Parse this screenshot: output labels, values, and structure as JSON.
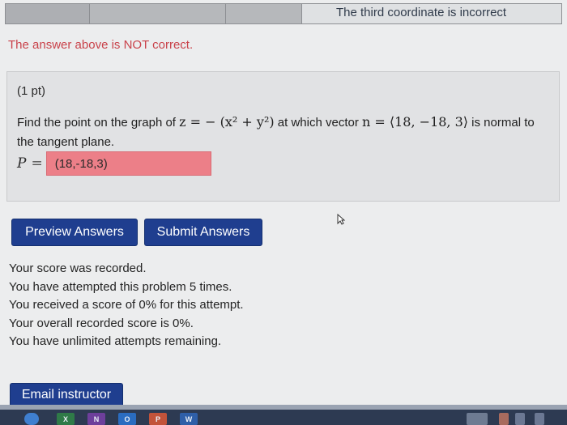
{
  "results_bar": {
    "message": "The third coordinate is incorrect"
  },
  "feedback": {
    "error_message": "The answer above is NOT correct."
  },
  "problem": {
    "points": "(1 pt)",
    "text_before": "Find the point on the graph of ",
    "math_surface": "z = − (x² + y²)",
    "text_middle": " at which vector ",
    "math_vector": "n = ⟨18, −18, 3⟩",
    "text_after": " is normal to the tangent plane.",
    "answer_label": "P",
    "answer_equals": "=",
    "answer_value": "(18,-18,3)"
  },
  "buttons": {
    "preview": "Preview Answers",
    "submit": "Submit Answers",
    "email": "Email instructor"
  },
  "score_messages": [
    "Your score was recorded.",
    "You have attempted this problem 5 times.",
    "You received a score of 0% for this attempt.",
    "Your overall recorded score is 0%.",
    "You have unlimited attempts remaining."
  ],
  "taskbar": {
    "icons": {
      "start": "windows-start-icon",
      "excel": "excel-icon",
      "onenote": "onenote-icon",
      "outlook": "outlook-icon",
      "powerpoint": "powerpoint-icon",
      "word": "word-icon"
    },
    "labels": {
      "excel": "X",
      "onenote": "N",
      "outlook": "O",
      "powerpoint": "P",
      "word": "W"
    }
  },
  "colors": {
    "error_text": "#c9424a",
    "incorrect_answer_fill": "#ec7f88",
    "button_blue": "#1f3e8f"
  }
}
